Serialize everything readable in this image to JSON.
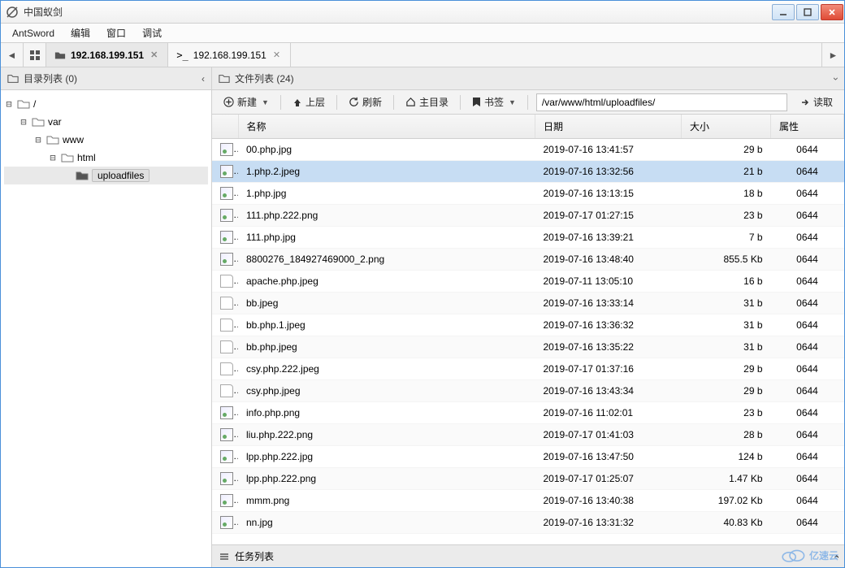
{
  "window": {
    "title": "中国蚁剑"
  },
  "menubar": [
    "AntSword",
    "编辑",
    "窗口",
    "调试"
  ],
  "tabs": [
    {
      "label": "192.168.199.151",
      "active": true,
      "icon": "folder"
    },
    {
      "label": "192.168.199.151",
      "active": false,
      "prefix": ">_"
    }
  ],
  "leftPanel": {
    "title": "目录列表 (0)"
  },
  "tree": [
    {
      "label": "/",
      "depth": 0,
      "expanded": true,
      "icon": "folder-open"
    },
    {
      "label": "var",
      "depth": 1,
      "expanded": true,
      "icon": "folder-open"
    },
    {
      "label": "www",
      "depth": 2,
      "expanded": true,
      "icon": "folder-open"
    },
    {
      "label": "html",
      "depth": 3,
      "expanded": true,
      "icon": "folder-open"
    },
    {
      "label": "uploadfiles",
      "depth": 4,
      "expanded": false,
      "icon": "folder-closed",
      "selected": true
    }
  ],
  "rightPanel": {
    "title": "文件列表 (24)"
  },
  "toolbar": {
    "new": "新建",
    "up": "上层",
    "refresh": "刷新",
    "home": "主目录",
    "bookmark": "书签",
    "path": "/var/www/html/uploadfiles/",
    "read": "读取"
  },
  "columns": {
    "name": "名称",
    "date": "日期",
    "size": "大小",
    "perm": "属性"
  },
  "files": [
    {
      "name": "00.php.jpg",
      "date": "2019-07-16 13:41:57",
      "size": "29 b",
      "perm": "0644",
      "ico": "img"
    },
    {
      "name": "1.php.2.jpeg",
      "date": "2019-07-16 13:32:56",
      "size": "21 b",
      "perm": "0644",
      "ico": "img",
      "selected": true
    },
    {
      "name": "1.php.jpg",
      "date": "2019-07-16 13:13:15",
      "size": "18 b",
      "perm": "0644",
      "ico": "img"
    },
    {
      "name": "111.php.222.png",
      "date": "2019-07-17 01:27:15",
      "size": "23 b",
      "perm": "0644",
      "ico": "img"
    },
    {
      "name": "111.php.jpg",
      "date": "2019-07-16 13:39:21",
      "size": "7 b",
      "perm": "0644",
      "ico": "img"
    },
    {
      "name": "8800276_184927469000_2.png",
      "date": "2019-07-16 13:48:40",
      "size": "855.5 Kb",
      "perm": "0644",
      "ico": "img"
    },
    {
      "name": "apache.php.jpeg",
      "date": "2019-07-11 13:05:10",
      "size": "16 b",
      "perm": "0644",
      "ico": "doc"
    },
    {
      "name": "bb.jpeg",
      "date": "2019-07-16 13:33:14",
      "size": "31 b",
      "perm": "0644",
      "ico": "doc"
    },
    {
      "name": "bb.php.1.jpeg",
      "date": "2019-07-16 13:36:32",
      "size": "31 b",
      "perm": "0644",
      "ico": "doc"
    },
    {
      "name": "bb.php.jpeg",
      "date": "2019-07-16 13:35:22",
      "size": "31 b",
      "perm": "0644",
      "ico": "doc"
    },
    {
      "name": "csy.php.222.jpeg",
      "date": "2019-07-17 01:37:16",
      "size": "29 b",
      "perm": "0644",
      "ico": "doc"
    },
    {
      "name": "csy.php.jpeg",
      "date": "2019-07-16 13:43:34",
      "size": "29 b",
      "perm": "0644",
      "ico": "doc"
    },
    {
      "name": "info.php.png",
      "date": "2019-07-16 11:02:01",
      "size": "23 b",
      "perm": "0644",
      "ico": "img"
    },
    {
      "name": "liu.php.222.png",
      "date": "2019-07-17 01:41:03",
      "size": "28 b",
      "perm": "0644",
      "ico": "img"
    },
    {
      "name": "lpp.php.222.jpg",
      "date": "2019-07-16 13:47:50",
      "size": "124 b",
      "perm": "0644",
      "ico": "img"
    },
    {
      "name": "lpp.php.222.png",
      "date": "2019-07-17 01:25:07",
      "size": "1.47 Kb",
      "perm": "0644",
      "ico": "img"
    },
    {
      "name": "mmm.png",
      "date": "2019-07-16 13:40:38",
      "size": "197.02 Kb",
      "perm": "0644",
      "ico": "img"
    },
    {
      "name": "nn.jpg",
      "date": "2019-07-16 13:31:32",
      "size": "40.83 Kb",
      "perm": "0644",
      "ico": "img"
    }
  ],
  "taskbar": {
    "title": "任务列表"
  },
  "watermark": "亿速云"
}
